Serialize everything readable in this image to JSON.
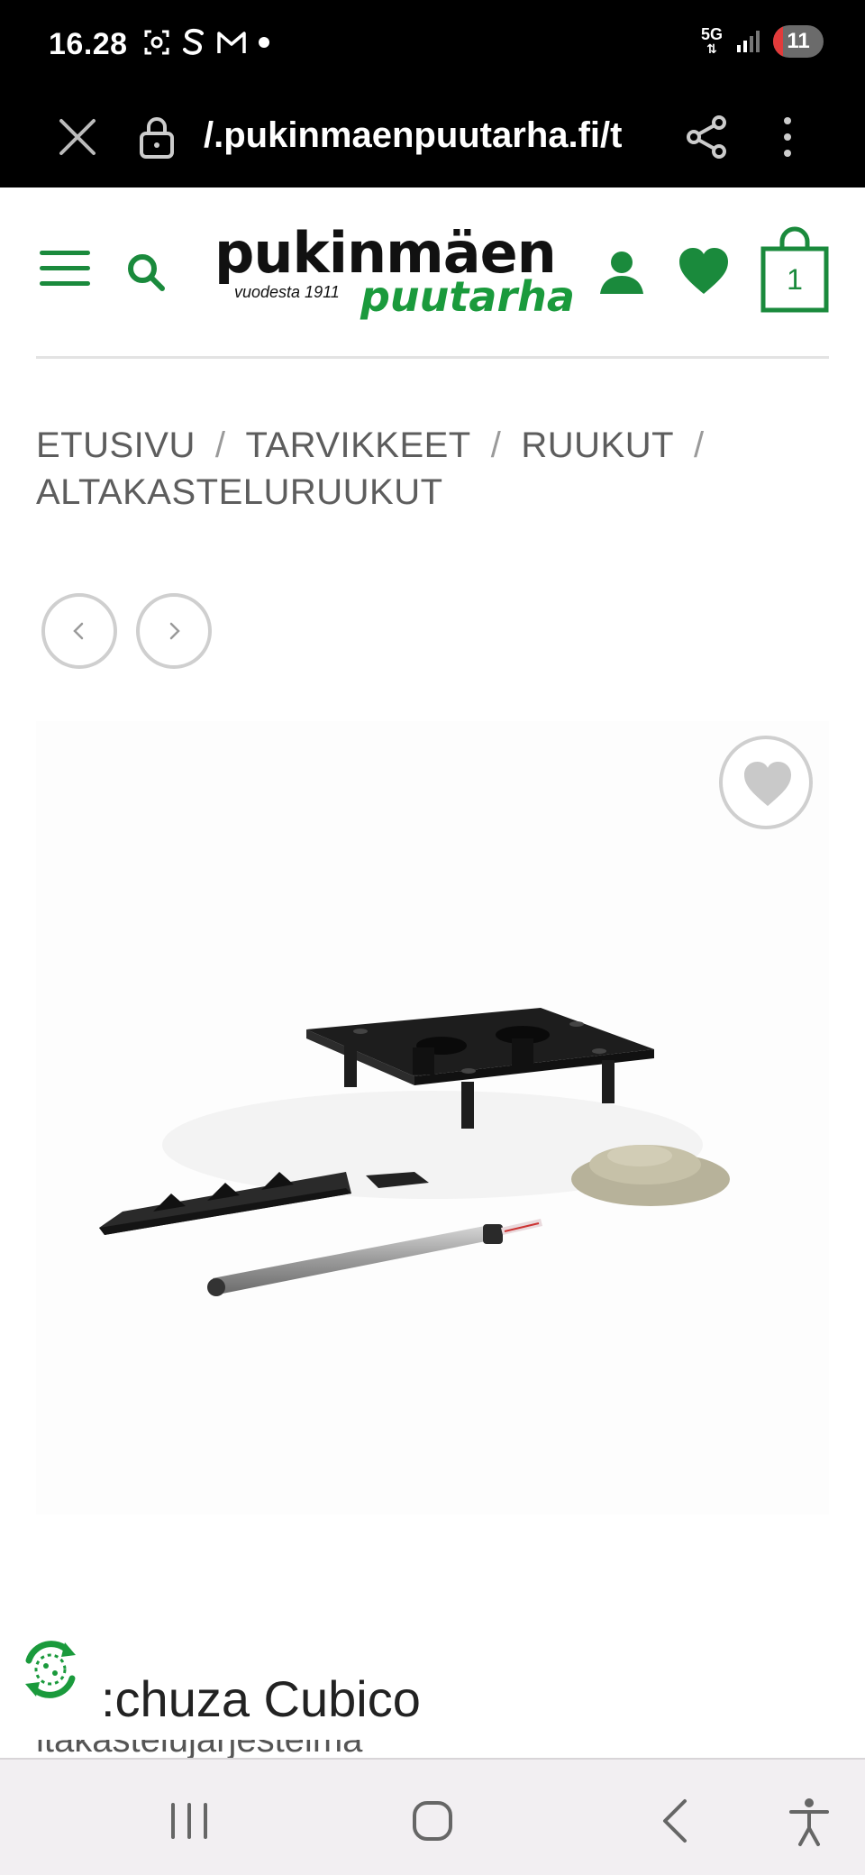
{
  "status_bar": {
    "time": "16.28",
    "network": "5G",
    "battery": "11",
    "battery_percent": 11,
    "icons": [
      "screenshot-icon",
      "s-icon",
      "gmail-icon",
      "dot-icon",
      "signal-icon"
    ]
  },
  "browser": {
    "url": "/.pukinmaenpuutarha.fi/t",
    "icons": [
      "close-icon",
      "lock-icon",
      "share-icon",
      "more-vert-icon"
    ]
  },
  "header": {
    "logo_main": "pukinmäen",
    "logo_since": "vuodesta 1911",
    "logo_sub": "puutarha",
    "cart_count": "1",
    "brand_color": "#1a8a3c",
    "icons": [
      "hamburger-icon",
      "search-icon",
      "user-icon",
      "heart-icon",
      "shopping-bag-icon"
    ]
  },
  "breadcrumb": {
    "items": [
      "ETUSIVU",
      "TARVIKKEET",
      "RUUKUT",
      "ALTAKASTELURUUKUT"
    ],
    "separator": "/"
  },
  "product": {
    "title": ":chuza Cubico",
    "subtitle_cut": "ltakastelujärjestelmä"
  },
  "android_nav": {
    "icons": [
      "recents-icon",
      "home-icon",
      "back-icon",
      "accessibility-icon"
    ]
  }
}
